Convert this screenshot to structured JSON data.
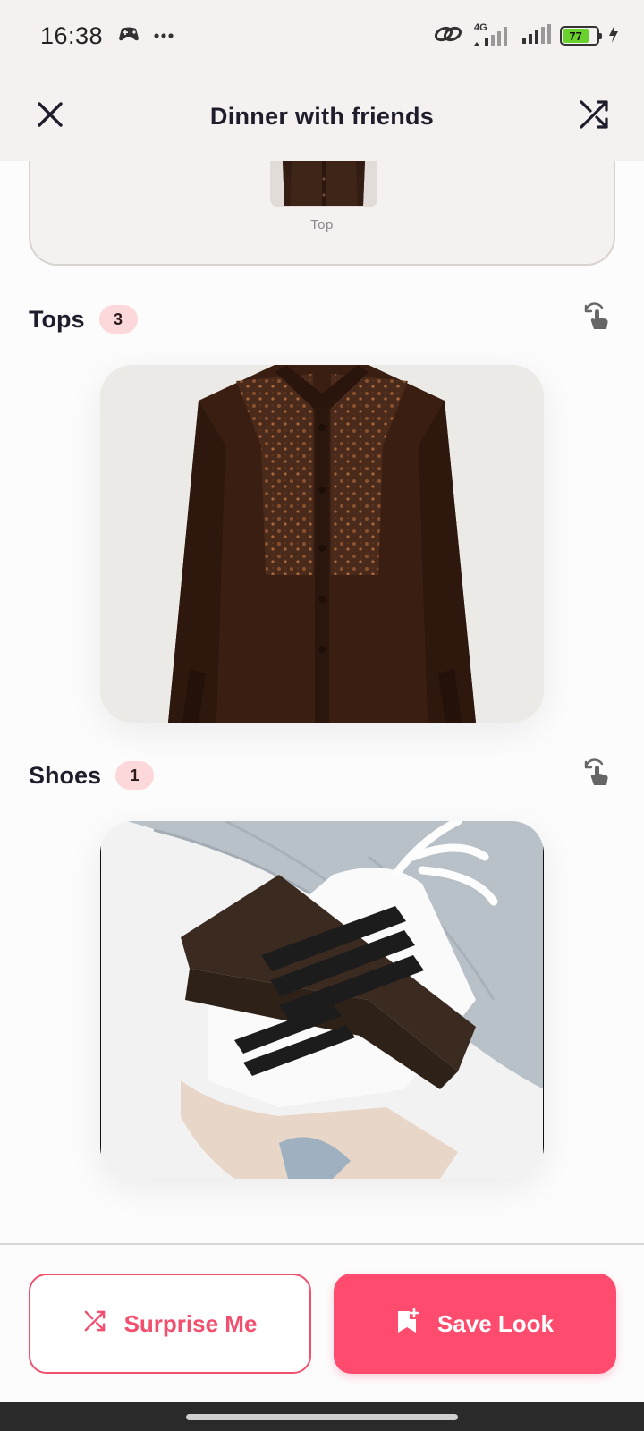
{
  "status_bar": {
    "time": "16:38",
    "network_type": "4G",
    "battery_level": "77",
    "battery_fraction": 0.77,
    "icons": [
      "game-controller-icon",
      "more-dots-icon",
      "link-icon",
      "signal-icon",
      "signal-icon",
      "battery-icon",
      "charging-icon"
    ]
  },
  "header": {
    "title": "Dinner with friends",
    "close_icon": "close-icon",
    "shuffle_icon": "shuffle-icon"
  },
  "preview": {
    "item_label": "Top"
  },
  "sections": [
    {
      "title": "Tops",
      "count": "3",
      "action_icon": "swipe-gesture-icon",
      "image": "brown embroidered shirt"
    },
    {
      "title": "Shoes",
      "count": "1",
      "action_icon": "swipe-gesture-icon",
      "image": "white sneakers with black stripes"
    }
  ],
  "actions": {
    "surprise_label": "Surprise Me",
    "save_label": "Save Look"
  },
  "colors": {
    "accent": "#fe4b6e",
    "badge_bg": "#fdd8da",
    "header_bg": "#f4f1f0"
  }
}
